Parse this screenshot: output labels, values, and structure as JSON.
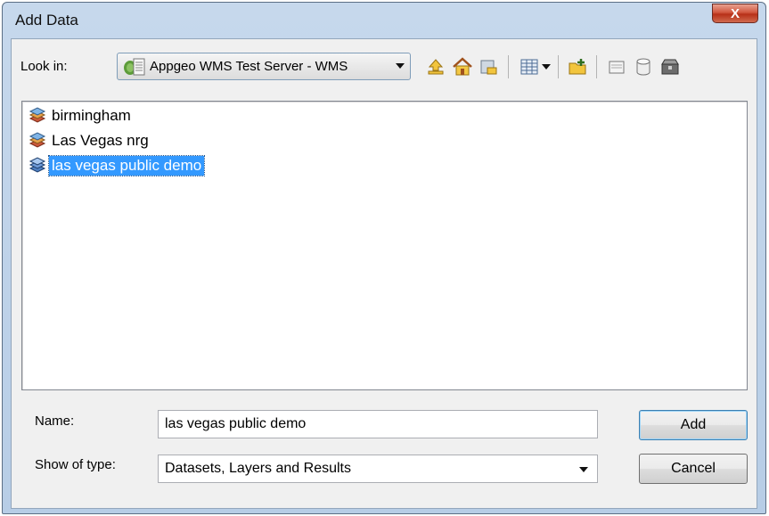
{
  "window": {
    "title": "Add Data",
    "close_glyph": "X"
  },
  "lookin": {
    "label": "Look in:",
    "value": "Appgeo WMS Test Server - WMS",
    "icon": "wms-server-icon"
  },
  "toolbar": {
    "icons": [
      "up-one-level-icon",
      "home-icon",
      "connect-folder-icon",
      "list-view-icon",
      "view-dropdown-icon",
      "new-folder-icon",
      "new-server-icon",
      "new-database-icon",
      "toolbox-icon"
    ]
  },
  "list": {
    "items": [
      {
        "label": "birmingham",
        "icon": "wms-layer-icon",
        "selected": false
      },
      {
        "label": "Las Vegas nrg",
        "icon": "wms-layer-icon",
        "selected": false
      },
      {
        "label": "las vegas public demo",
        "icon": "wms-layer-icon",
        "selected": true
      }
    ]
  },
  "name": {
    "label": "Name:",
    "value": "las vegas public demo"
  },
  "show_type": {
    "label": "Show of type:",
    "value": "Datasets, Layers and Results"
  },
  "buttons": {
    "add": "Add",
    "cancel": "Cancel"
  },
  "colors": {
    "selection": "#3399ff",
    "title_bar": "#b9cfe7",
    "close_button": "#c7432b"
  }
}
